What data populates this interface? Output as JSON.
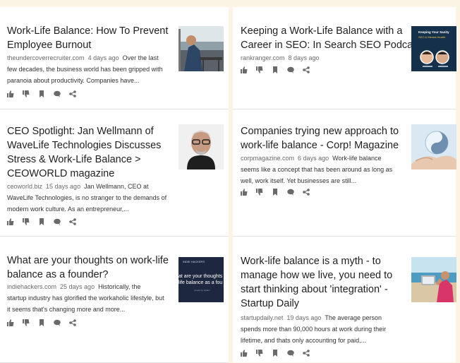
{
  "articles": [
    {
      "title_lines": [
        "Work-Life Balance: How To Prevent",
        "Employee Burnout"
      ],
      "source": "theundercoverrecruiter.com",
      "age": "4 days ago",
      "snippet_lines": [
        "Over the last",
        "few decades, the business world has been gripped with",
        "paranoia about productivity. Companies have..."
      ]
    },
    {
      "title_lines": [
        "Keeping a Work-Life Balance with a",
        "Career in SEO: In Search SEO Podcast"
      ],
      "source": "rankranger.com",
      "age": "8 days ago",
      "snippet_lines": [],
      "thumb_text": [
        "Keeping Your Sanity",
        "SEO & Mental Health"
      ]
    },
    {
      "title_lines": [
        "CEO Spotlight: Jan Wellmann of",
        "WaveLife Technologies Discusses",
        "Stress & Work-Life Balance >",
        "CEOWORLD magazine"
      ],
      "source": "ceoworld.biz",
      "age": "15 days ago",
      "snippet_lines": [
        "Jan Wellmann, CEO at",
        "WaveLife Technologies, is no stranger to the demands of",
        "modern work culture. As an entrepreneur,..."
      ]
    },
    {
      "title_lines": [
        "Companies trying new approach to",
        "work-life balance - Corp! Magazine"
      ],
      "source": "corpmagazine.com",
      "age": "6 days ago",
      "snippet_lines": [
        "Work-life balance",
        "seems like a concept that has been around as long as",
        "well, work itself. Yet businesses are still..."
      ]
    },
    {
      "title_lines": [
        "What are your thoughts on work-life",
        "balance as a founder?"
      ],
      "source": "indiehackers.com",
      "age": "25 days ago",
      "snippet_lines": [
        "Historically, the",
        "startup industry has glorified the workaholic lifestyle, but",
        "it seems that's changing more and more..."
      ],
      "thumb_text": [
        "INDIE HACKERS",
        "at are your thoughts",
        "life balance as a fou",
        "posted by builder"
      ]
    },
    {
      "title_lines": [
        "Work-life balance is a myth - to",
        "manage how we live, you need to",
        "start thinking about 'integration' -",
        "Startup Daily"
      ],
      "source": "startupdaily.net",
      "age": "19 days ago",
      "snippet_lines": [
        "The average person",
        "spends more than 90,000 hours at work during their",
        "lifetime, and thats only accounting for paid,..."
      ]
    }
  ],
  "icons": [
    "thumbs-up-icon",
    "thumbs-down-icon",
    "bookmark-icon",
    "comment-icon",
    "share-icon"
  ],
  "colors": {
    "background": "#fbf3e4",
    "card": "#ffffff",
    "icon": "#6a6a6a",
    "title": "#1f1f1f"
  }
}
